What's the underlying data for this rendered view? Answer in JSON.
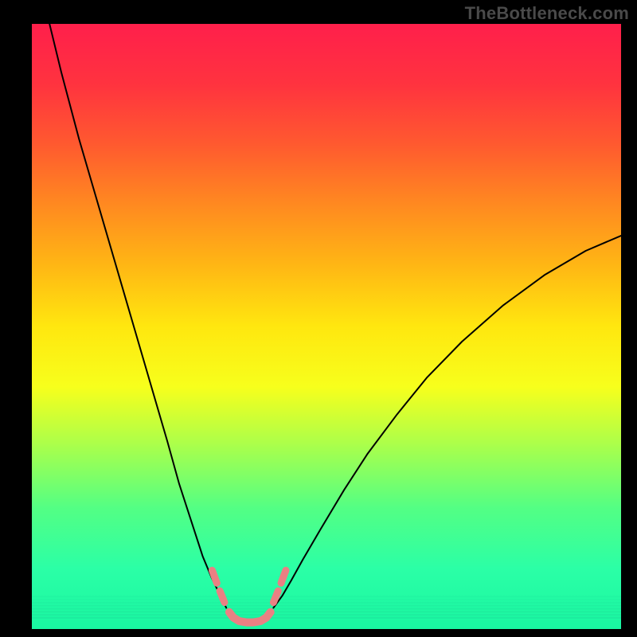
{
  "watermark": "TheBottleneck.com",
  "chart_data": {
    "type": "line",
    "title": "",
    "xlabel": "",
    "ylabel": "",
    "xlim": [
      0,
      100
    ],
    "ylim": [
      0,
      100
    ],
    "grid": false,
    "background_gradient_colors": [
      "#ff1f4b",
      "#ff333f",
      "#ff5a2f",
      "#ff8a20",
      "#ffb714",
      "#ffe70f",
      "#f7ff1c",
      "#a7ff4d",
      "#53ff84",
      "#2bffa6",
      "#19f7a2"
    ],
    "thin_green_bands_y": [
      5.5,
      5.0,
      4.5,
      4.0,
      3.5,
      3.0,
      2.5,
      2.0
    ],
    "series": [
      {
        "name": "left-curve",
        "stroke": "#000000",
        "width": 2,
        "x": [
          3,
          5,
          8,
          11,
          14,
          17,
          20,
          23,
          25,
          27,
          29,
          30.5,
          32,
          33
        ],
        "y": [
          100,
          92,
          81,
          71,
          61,
          51,
          41,
          31,
          24,
          18,
          12,
          8.5,
          5.5,
          3.5
        ]
      },
      {
        "name": "right-curve",
        "stroke": "#000000",
        "width": 2,
        "x": [
          41,
          42.5,
          44,
          46,
          49,
          53,
          57,
          62,
          67,
          73,
          80,
          87,
          94,
          100
        ],
        "y": [
          3.5,
          5.5,
          8.0,
          11.5,
          16.5,
          23,
          29,
          35.5,
          41.5,
          47.5,
          53.5,
          58.5,
          62.5,
          65
        ]
      },
      {
        "name": "u-floor",
        "stroke": "#ea8083",
        "width": 10,
        "x": [
          33.5,
          34.2,
          35.2,
          36.5,
          37.5,
          38.8,
          39.8,
          40.5
        ],
        "y": [
          2.8,
          1.9,
          1.3,
          1.1,
          1.1,
          1.3,
          1.9,
          2.8
        ]
      }
    ],
    "accent_nubs": {
      "stroke": "#ea8083",
      "width": 9,
      "segments": [
        {
          "x": [
            30.6,
            31.4
          ],
          "y": [
            9.7,
            7.6
          ]
        },
        {
          "x": [
            31.9,
            32.7
          ],
          "y": [
            6.3,
            4.4
          ]
        },
        {
          "x": [
            41.0,
            41.8
          ],
          "y": [
            4.4,
            6.3
          ]
        },
        {
          "x": [
            42.3,
            43.1
          ],
          "y": [
            7.6,
            9.7
          ]
        }
      ]
    }
  }
}
